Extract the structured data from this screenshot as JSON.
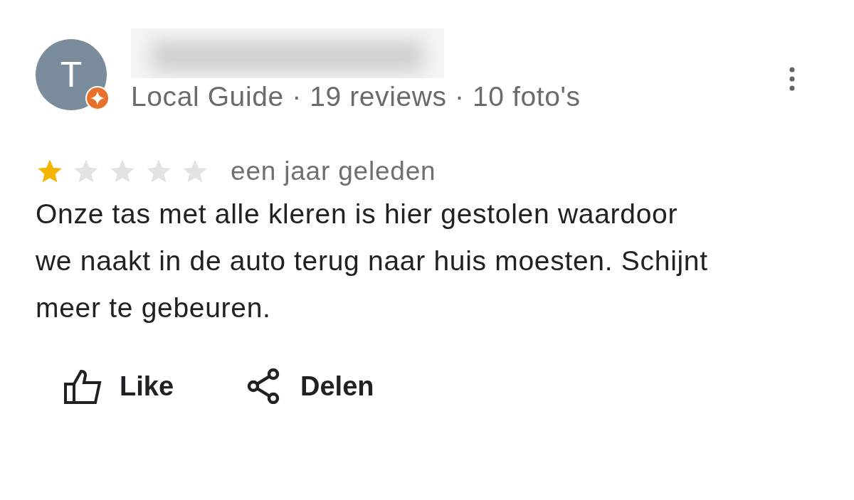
{
  "review": {
    "avatar_letter": "T",
    "local_guide": true,
    "meta": "Local Guide · 19 reviews · 10 foto's",
    "stars": 1,
    "time": "een jaar geleden",
    "text": "Onze tas met alle kleren is hier gestolen waardoor we naakt in de auto terug naar huis moesten. Schijnt meer te gebeuren."
  },
  "actions": [
    {
      "kind": "like",
      "label": "Like"
    },
    {
      "kind": "share",
      "label": "Delen"
    }
  ]
}
